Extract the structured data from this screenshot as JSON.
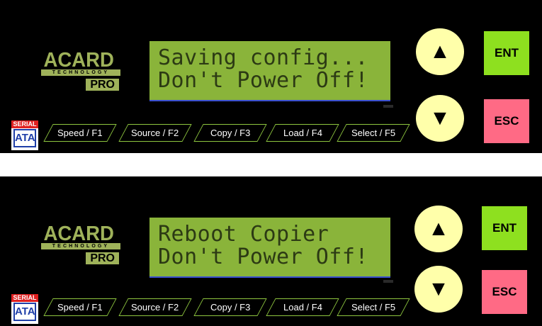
{
  "panels": [
    {
      "logo": {
        "brand": "ACARD",
        "tagline": "TECHNOLOGY",
        "edition": "PRO"
      },
      "lcd": {
        "line1": "Saving config...",
        "line2": "Don't Power Off!"
      },
      "sata": {
        "top": "SERIAL",
        "bottom": "ATA"
      },
      "function_keys": [
        "Speed / F1",
        "Source / F2",
        "Copy / F3",
        "Load / F4",
        "Select / F5"
      ],
      "buttons": {
        "up": "▲",
        "down": "▼",
        "enter": "ENT",
        "escape": "ESC"
      }
    },
    {
      "logo": {
        "brand": "ACARD",
        "tagline": "TECHNOLOGY",
        "edition": "PRO"
      },
      "lcd": {
        "line1": "Reboot Copier",
        "line2": "Don't Power Off!"
      },
      "sata": {
        "top": "SERIAL",
        "bottom": "ATA"
      },
      "function_keys": [
        "Speed / F1",
        "Source / F2",
        "Copy / F3",
        "Load / F4",
        "Select / F5"
      ],
      "buttons": {
        "up": "▲",
        "down": "▼",
        "enter": "ENT",
        "escape": "ESC"
      }
    }
  ],
  "colors": {
    "lcd_background": "#8ab43a",
    "lcd_text": "#2c3a14",
    "logo": "#9fb25a",
    "function_key_outline": "#8ec63f",
    "arrow_button": "#ffffaa",
    "enter_button": "#8ee01f",
    "escape_button": "#ff6a85"
  },
  "icons": {
    "up": "up-triangle-icon",
    "down": "down-triangle-icon",
    "sata": "serial-ata-logo"
  }
}
